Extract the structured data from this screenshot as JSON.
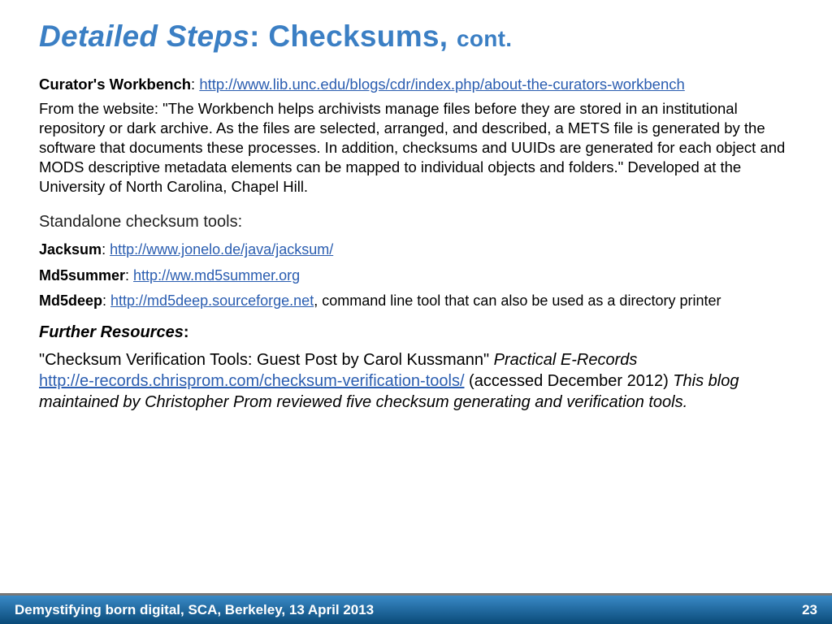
{
  "title": {
    "part1": "Detailed Steps",
    "part2": ": Checksums, ",
    "part3": "cont."
  },
  "curator": {
    "label": "Curator's Workbench",
    "url": "http://www.lib.unc.edu/blogs/cdr/index.php/about-the-curators-workbench",
    "desc": "From the website: \"The Workbench helps archivists manage files before they are stored in an institutional repository or dark archive. As the files are selected, arranged, and described, a METS file is generated by the software that documents these processes. In addition, checksums and UUIDs are generated for each object and MODS descriptive metadata elements can be mapped to individual objects and folders.\" Developed at the University of North Carolina, Chapel Hill."
  },
  "standalone_heading": "Standalone checksum tools:",
  "tools": {
    "jacksum": {
      "label": "Jacksum",
      "url": "http://www.jonelo.de/java/jacksum/"
    },
    "md5summer": {
      "label": "Md5summer",
      "url": "http://ww.md5summer.org"
    },
    "md5deep": {
      "label": "Md5deep",
      "url": "http://md5deep.sourceforge.net",
      "tail": ", command line tool that can also be used as a directory printer"
    }
  },
  "further": {
    "heading_italic": "Further Resources",
    "heading_colon": ":",
    "quote_prefix": " \"Checksum Verification Tools: Guest Post by Carol Kussmann\" ",
    "quote_source": "Practical E-Records",
    "url": "http://e-records.chrisprom.com/checksum-verification-tools/",
    "accessed": "  (accessed December 2012) ",
    "note": "This blog maintained by Christopher Prom reviewed five checksum generating and verification tools."
  },
  "footer": {
    "text": "Demystifying born digital, SCA, Berkeley, 13 April 2013",
    "page": "23"
  }
}
